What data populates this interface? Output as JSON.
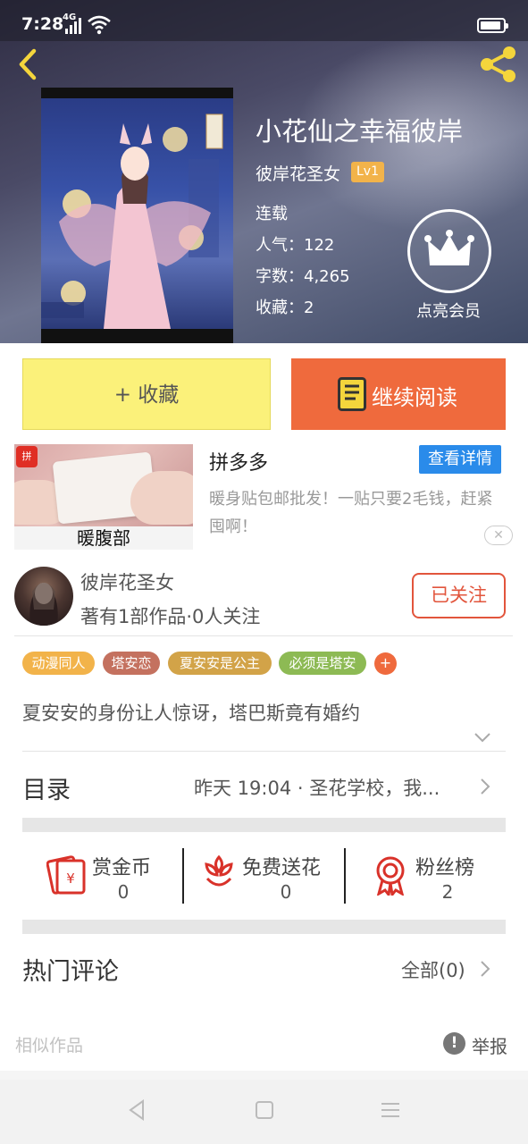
{
  "status": {
    "time": "7:28",
    "network": "4G"
  },
  "book": {
    "title": "小花仙之幸福彼岸",
    "author": "彼岸花圣女",
    "level": "Lv1",
    "state": "连载",
    "popularity": "人气：122",
    "words": "字数：4,265",
    "favorites": "收藏：2",
    "vip_label": "点亮会员"
  },
  "actions": {
    "collect": "+ 收藏",
    "read": "继续阅读"
  },
  "ad": {
    "caption": "暖腹部",
    "name": "拼多多",
    "detail": "查看详情",
    "desc": "暖身贴包邮批发！一贴只要2毛钱，赶紧囤啊！",
    "logo": "拼"
  },
  "author_info": {
    "name": "彼岸花圣女",
    "stats": "著有1部作品·0人关注",
    "follow": "已关注"
  },
  "tags": [
    {
      "label": "动漫同人",
      "color": "#f2b34a"
    },
    {
      "label": "塔安恋",
      "color": "#c4715f"
    },
    {
      "label": "夏安安是公主",
      "color": "#d2a348"
    },
    {
      "label": "必须是塔安",
      "color": "#8dba54"
    }
  ],
  "tag_more": "+",
  "summary": "夏安安的身份让人惊讶，塔巴斯竟有婚约",
  "catalog": {
    "title": "目录",
    "update": "昨天 19:04 · 圣花学校，我..."
  },
  "rewards": {
    "coin": {
      "label": "赏金币",
      "value": "0"
    },
    "flower": {
      "label": "免费送花",
      "value": "0"
    },
    "fans": {
      "label": "粉丝榜",
      "value": "2"
    }
  },
  "comments": {
    "title": "热门评论",
    "all": "全部(0)"
  },
  "footer": {
    "similar": "相似作品",
    "report": "举报"
  },
  "colors": {
    "accent": "#ef6a3d",
    "collect_bg": "#fbf17a",
    "reward_icon": "#d9322a",
    "ad_button": "#2a8bea"
  }
}
